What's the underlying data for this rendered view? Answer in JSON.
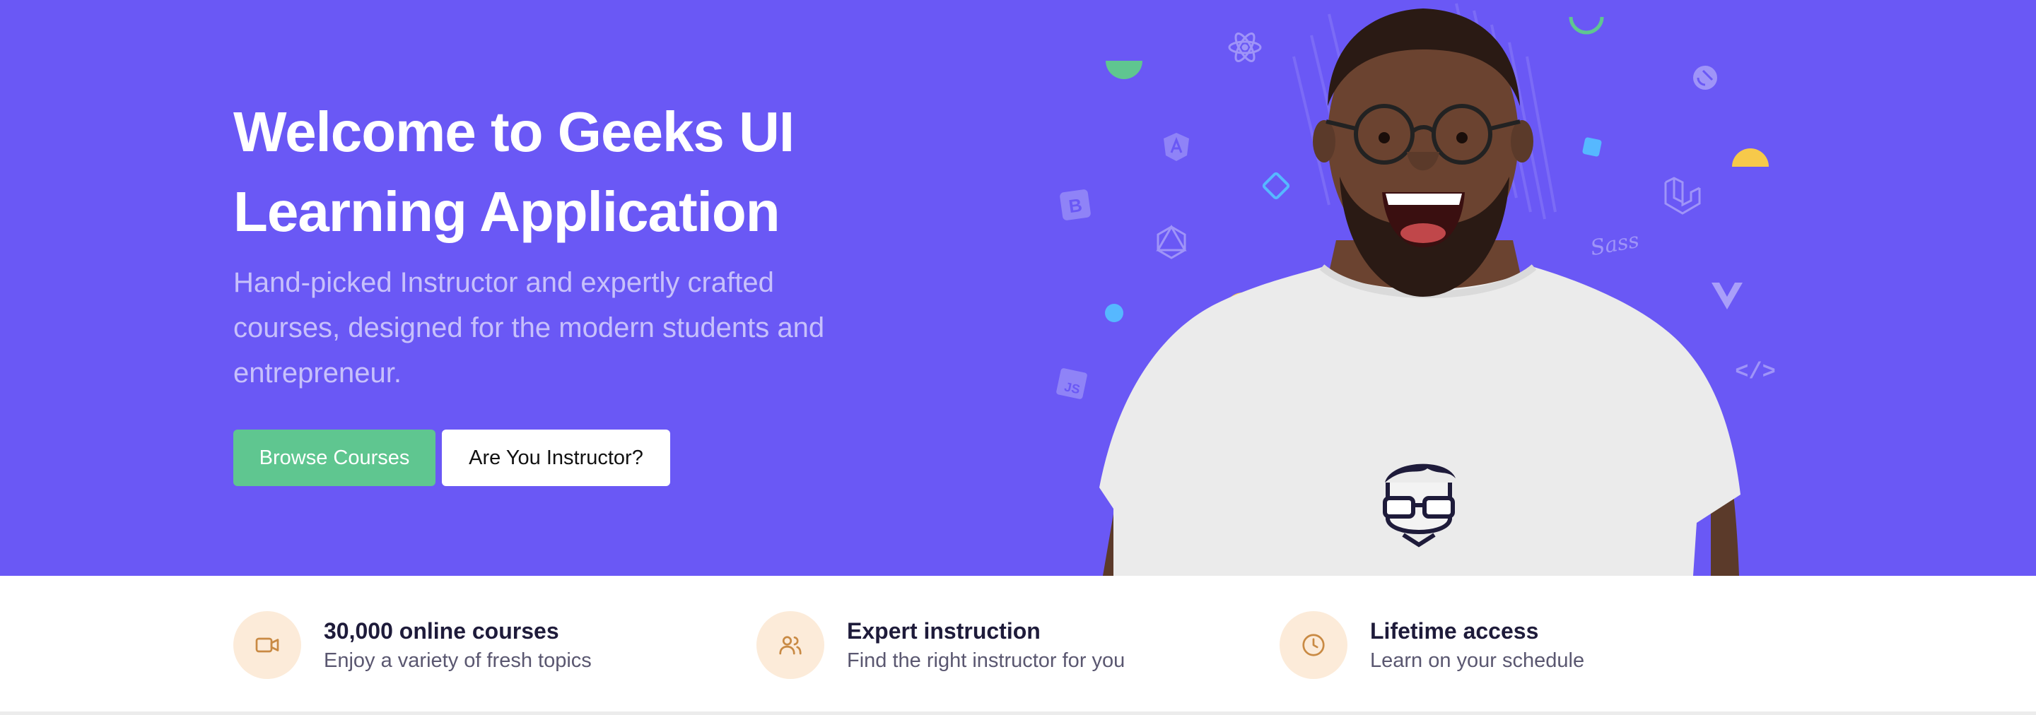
{
  "hero": {
    "title_line1": "Welcome to Geeks UI",
    "title_line2": "Learning Application",
    "description_line1": "Hand-picked Instructor and expertly crafted",
    "description_line2": "courses, designed for the modern students and",
    "description_line3": "entrepreneur.",
    "browse_label": "Browse Courses",
    "instructor_label": "Are You Instructor?",
    "background_color": "#6A58F5",
    "browse_color": "#5FC690"
  },
  "illustration": {
    "tech_icons": [
      "react-icon",
      "angular-icon",
      "bootstrap-icon",
      "graphql-icon",
      "javascript-icon",
      "gatsby-icon",
      "laravel-icon",
      "sass-icon",
      "vue-icon",
      "code-icon"
    ],
    "tech_labels": {
      "bootstrap": "B",
      "javascript": "JS",
      "sass": "Sass",
      "code": "</>"
    }
  },
  "features": [
    {
      "icon": "video-icon",
      "title": "30,000 online courses",
      "subtitle": "Enjoy a variety of fresh topics"
    },
    {
      "icon": "users-icon",
      "title": "Expert instruction",
      "subtitle": "Find the right instructor for you"
    },
    {
      "icon": "clock-icon",
      "title": "Lifetime access",
      "subtitle": "Learn on your schedule"
    }
  ],
  "colors": {
    "feature_icon_bg": "#FCEBD9",
    "feature_icon_stroke": "#C98A44"
  }
}
